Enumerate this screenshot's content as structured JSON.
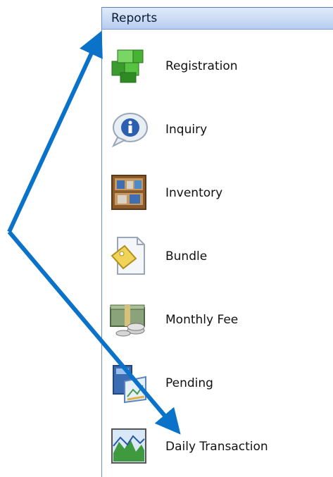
{
  "panel": {
    "title": "Reports",
    "items": [
      {
        "label": "Registration",
        "icon": "green-cubes-icon"
      },
      {
        "label": "Inquiry",
        "icon": "info-bubble-icon"
      },
      {
        "label": "Inventory",
        "icon": "shelf-icon"
      },
      {
        "label": "Bundle",
        "icon": "document-tag-icon"
      },
      {
        "label": "Monthly Fee",
        "icon": "money-stack-icon"
      },
      {
        "label": "Pending",
        "icon": "pending-document-icon"
      },
      {
        "label": "Daily Transaction",
        "icon": "chart-icon"
      }
    ]
  },
  "colors": {
    "header_gradient_top": "#e1ecfb",
    "header_gradient_bottom": "#b7cdef",
    "annotation_arrow": "#0a73c9"
  }
}
